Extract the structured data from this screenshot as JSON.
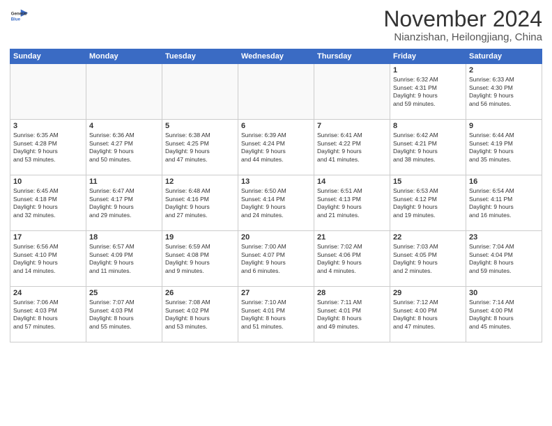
{
  "header": {
    "logo_line1": "General",
    "logo_line2": "Blue",
    "month": "November 2024",
    "location": "Nianzishan, Heilongjiang, China"
  },
  "weekdays": [
    "Sunday",
    "Monday",
    "Tuesday",
    "Wednesday",
    "Thursday",
    "Friday",
    "Saturday"
  ],
  "weeks": [
    [
      {
        "day": "",
        "text": ""
      },
      {
        "day": "",
        "text": ""
      },
      {
        "day": "",
        "text": ""
      },
      {
        "day": "",
        "text": ""
      },
      {
        "day": "",
        "text": ""
      },
      {
        "day": "1",
        "text": "Sunrise: 6:32 AM\nSunset: 4:31 PM\nDaylight: 9 hours\nand 59 minutes."
      },
      {
        "day": "2",
        "text": "Sunrise: 6:33 AM\nSunset: 4:30 PM\nDaylight: 9 hours\nand 56 minutes."
      }
    ],
    [
      {
        "day": "3",
        "text": "Sunrise: 6:35 AM\nSunset: 4:28 PM\nDaylight: 9 hours\nand 53 minutes."
      },
      {
        "day": "4",
        "text": "Sunrise: 6:36 AM\nSunset: 4:27 PM\nDaylight: 9 hours\nand 50 minutes."
      },
      {
        "day": "5",
        "text": "Sunrise: 6:38 AM\nSunset: 4:25 PM\nDaylight: 9 hours\nand 47 minutes."
      },
      {
        "day": "6",
        "text": "Sunrise: 6:39 AM\nSunset: 4:24 PM\nDaylight: 9 hours\nand 44 minutes."
      },
      {
        "day": "7",
        "text": "Sunrise: 6:41 AM\nSunset: 4:22 PM\nDaylight: 9 hours\nand 41 minutes."
      },
      {
        "day": "8",
        "text": "Sunrise: 6:42 AM\nSunset: 4:21 PM\nDaylight: 9 hours\nand 38 minutes."
      },
      {
        "day": "9",
        "text": "Sunrise: 6:44 AM\nSunset: 4:19 PM\nDaylight: 9 hours\nand 35 minutes."
      }
    ],
    [
      {
        "day": "10",
        "text": "Sunrise: 6:45 AM\nSunset: 4:18 PM\nDaylight: 9 hours\nand 32 minutes."
      },
      {
        "day": "11",
        "text": "Sunrise: 6:47 AM\nSunset: 4:17 PM\nDaylight: 9 hours\nand 29 minutes."
      },
      {
        "day": "12",
        "text": "Sunrise: 6:48 AM\nSunset: 4:16 PM\nDaylight: 9 hours\nand 27 minutes."
      },
      {
        "day": "13",
        "text": "Sunrise: 6:50 AM\nSunset: 4:14 PM\nDaylight: 9 hours\nand 24 minutes."
      },
      {
        "day": "14",
        "text": "Sunrise: 6:51 AM\nSunset: 4:13 PM\nDaylight: 9 hours\nand 21 minutes."
      },
      {
        "day": "15",
        "text": "Sunrise: 6:53 AM\nSunset: 4:12 PM\nDaylight: 9 hours\nand 19 minutes."
      },
      {
        "day": "16",
        "text": "Sunrise: 6:54 AM\nSunset: 4:11 PM\nDaylight: 9 hours\nand 16 minutes."
      }
    ],
    [
      {
        "day": "17",
        "text": "Sunrise: 6:56 AM\nSunset: 4:10 PM\nDaylight: 9 hours\nand 14 minutes."
      },
      {
        "day": "18",
        "text": "Sunrise: 6:57 AM\nSunset: 4:09 PM\nDaylight: 9 hours\nand 11 minutes."
      },
      {
        "day": "19",
        "text": "Sunrise: 6:59 AM\nSunset: 4:08 PM\nDaylight: 9 hours\nand 9 minutes."
      },
      {
        "day": "20",
        "text": "Sunrise: 7:00 AM\nSunset: 4:07 PM\nDaylight: 9 hours\nand 6 minutes."
      },
      {
        "day": "21",
        "text": "Sunrise: 7:02 AM\nSunset: 4:06 PM\nDaylight: 9 hours\nand 4 minutes."
      },
      {
        "day": "22",
        "text": "Sunrise: 7:03 AM\nSunset: 4:05 PM\nDaylight: 9 hours\nand 2 minutes."
      },
      {
        "day": "23",
        "text": "Sunrise: 7:04 AM\nSunset: 4:04 PM\nDaylight: 8 hours\nand 59 minutes."
      }
    ],
    [
      {
        "day": "24",
        "text": "Sunrise: 7:06 AM\nSunset: 4:03 PM\nDaylight: 8 hours\nand 57 minutes."
      },
      {
        "day": "25",
        "text": "Sunrise: 7:07 AM\nSunset: 4:03 PM\nDaylight: 8 hours\nand 55 minutes."
      },
      {
        "day": "26",
        "text": "Sunrise: 7:08 AM\nSunset: 4:02 PM\nDaylight: 8 hours\nand 53 minutes."
      },
      {
        "day": "27",
        "text": "Sunrise: 7:10 AM\nSunset: 4:01 PM\nDaylight: 8 hours\nand 51 minutes."
      },
      {
        "day": "28",
        "text": "Sunrise: 7:11 AM\nSunset: 4:01 PM\nDaylight: 8 hours\nand 49 minutes."
      },
      {
        "day": "29",
        "text": "Sunrise: 7:12 AM\nSunset: 4:00 PM\nDaylight: 8 hours\nand 47 minutes."
      },
      {
        "day": "30",
        "text": "Sunrise: 7:14 AM\nSunset: 4:00 PM\nDaylight: 8 hours\nand 45 minutes."
      }
    ]
  ]
}
